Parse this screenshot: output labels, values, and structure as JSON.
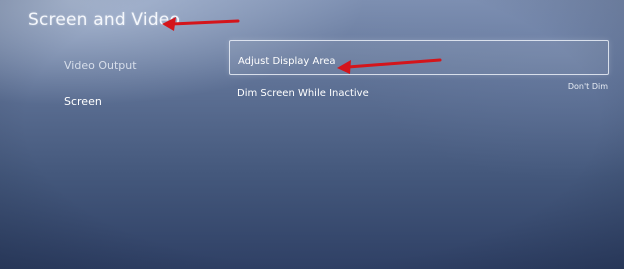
{
  "header": {
    "title": "Screen and Video"
  },
  "sidebar": {
    "items": [
      {
        "label": "Video Output"
      },
      {
        "label": "Screen"
      }
    ]
  },
  "settings": {
    "rows": [
      {
        "label": "Adjust Display Area",
        "value": ""
      },
      {
        "label": "Dim Screen While Inactive",
        "value": "Don't Dim"
      }
    ]
  },
  "annotations": {
    "arrow_color": "#d4151b"
  },
  "colors": {
    "background_top": "#7d8fb1",
    "background_bottom": "#2f4065",
    "text": "#ffffff"
  }
}
